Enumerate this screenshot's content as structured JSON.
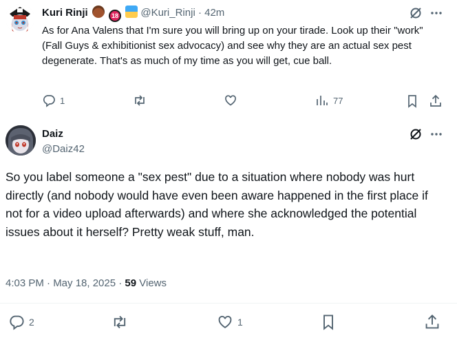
{
  "reply": {
    "display_name": "Kuri Rinji",
    "handle": "@Kuri_Rinji",
    "separator": "·",
    "time": "42m",
    "badge_18": "18",
    "text": "As for Ana Valens that I'm sure you will bring up on your tirade. Look up their \"work\" (Fall Guys & exhibitionist sex advocacy) and see why they are an actual sex pest degenerate. That's as much of my time as you will get, cue ball.",
    "replies": "1",
    "views": "77"
  },
  "main": {
    "display_name": "Daiz",
    "handle": "@Daiz42",
    "text": "So you label someone a \"sex pest\" due to a situation where nobody was hurt directly (and nobody would have even been aware happened in the first place if not for a video upload afterwards) and where she acknowledged the potential issues about it herself? Pretty weak stuff, man.",
    "timestamp": "4:03 PM · May 18, 2025 · ",
    "views_count": "59",
    "views_label": " Views",
    "replies": "2",
    "likes": "1"
  },
  "colors": {
    "text": "#0f1419",
    "muted": "#536471",
    "divider": "#eff3f4"
  },
  "icons": [
    "grok-icon",
    "more-icon",
    "reply-icon",
    "retweet-icon",
    "like-icon",
    "views-icon",
    "bookmark-icon",
    "share-icon"
  ]
}
